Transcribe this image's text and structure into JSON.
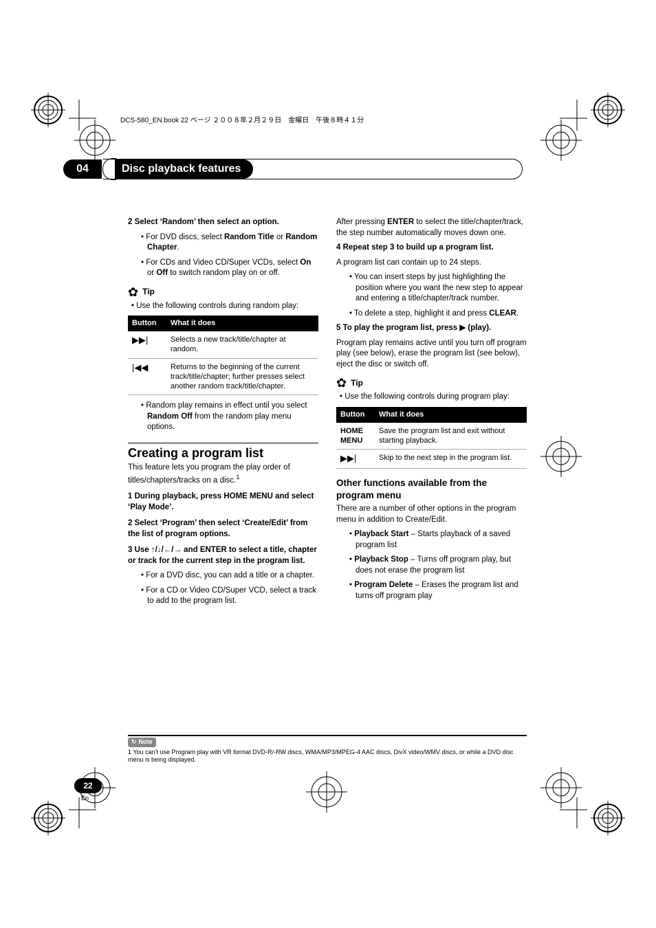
{
  "header": {
    "line": "DCS-580_EN.book  22 ページ  ２００８年２月２９日　金曜日　午後８時４１分"
  },
  "chapter": {
    "num": "04",
    "title": "Disc playback features"
  },
  "left": {
    "step2": "2   Select ‘Random’ then select an option.",
    "b1a": "For DVD discs, select ",
    "b1b": "Random Title",
    "b1c": " or ",
    "b1d": "Random Chapter",
    "b1e": ".",
    "b2a": "For CDs and Video CD/Super VCDs, select ",
    "b2b": "On",
    "b2c": " or ",
    "b2d": "Off",
    "b2e": " to switch random play on or off.",
    "tip_label": "Tip",
    "tip_bullet": "Use the following controls during random play:",
    "table": {
      "h1": "Button",
      "h2": "What it does",
      "r1_icon": "▶▶|",
      "r1_txt": "Selects a new track/title/chapter at random.",
      "r2_icon": "|◀◀",
      "r2_txt": "Returns to the beginning of the current track/title/chapter; further presses select another random track/title/chapter."
    },
    "after_a": "Random play remains in effect until you select ",
    "after_b": "Random Off",
    "after_c": " from the random play menu options.",
    "h2": "Creating a program list",
    "intro": "This feature lets you program the play order of titles/chapters/tracks on a disc.",
    "intro_sup": "1",
    "s1": "1   During playback, press HOME MENU and select ‘Play Mode’.",
    "s2": "2   Select ‘Program’ then select ‘Create/Edit’ from the list of program options.",
    "s3a": "3   Use ",
    "s3b": "↑/↓/←/→",
    "s3c": " and ENTER to select a title, chapter or track for the current step in the program list.",
    "s3_b1": "For a DVD disc, you can add a title or a chapter.",
    "s3_b2": "For a CD or Video CD/Super VCD, select a track to add to the program list."
  },
  "right": {
    "p1a": "After pressing ",
    "p1b": "ENTER",
    "p1c": " to select the title/chapter/track, the step number automatically moves down one.",
    "s4": "4   Repeat step 3 to build up a program list.",
    "s4_p": "A program list can contain up to 24 steps.",
    "s4_b1": "You can insert steps by just highlighting the position where you want the new step to appear and entering a title/chapter/track number.",
    "s4_b2a": "To delete a step, highlight it and press ",
    "s4_b2b": "CLEAR",
    "s4_b2c": ".",
    "s5a": "5   To play the program list, press ",
    "s5b": "▶",
    "s5c": " (play).",
    "s5_p": "Program play remains active until you turn off program play (see below), erase the program list (see below), eject the disc or switch off.",
    "tip_label": "Tip",
    "tip_bullet": "Use the following controls during program play:",
    "table": {
      "h1": "Button",
      "h2": "What it does",
      "r1_a": "HOME MENU",
      "r1_txt": "Save the program list and exit without starting playback.",
      "r2_icon": "▶▶|",
      "r2_txt": "Skip to the next step in the program list."
    },
    "h3": "Other functions available from the program menu",
    "h3_p": "There are a number of other options in the program menu in addition to Create/Edit.",
    "b1a": "Playback Start",
    "b1b": " – Starts playback of a saved program list",
    "b2a": "Playback Stop",
    "b2b": " – Turns off program play, but does not erase the program list",
    "b3a": "Program Delete",
    "b3b": " – Erases the program list and turns off program play"
  },
  "note": {
    "label": "Note",
    "text": "1 You can’t use Program play with VR format DVD-R/-RW discs, WMA/MP3/MPEG-4 AAC discs, DivX video/WMV discs, or while a DVD disc menu is being displayed."
  },
  "footer": {
    "page": "22",
    "lang": "En"
  }
}
